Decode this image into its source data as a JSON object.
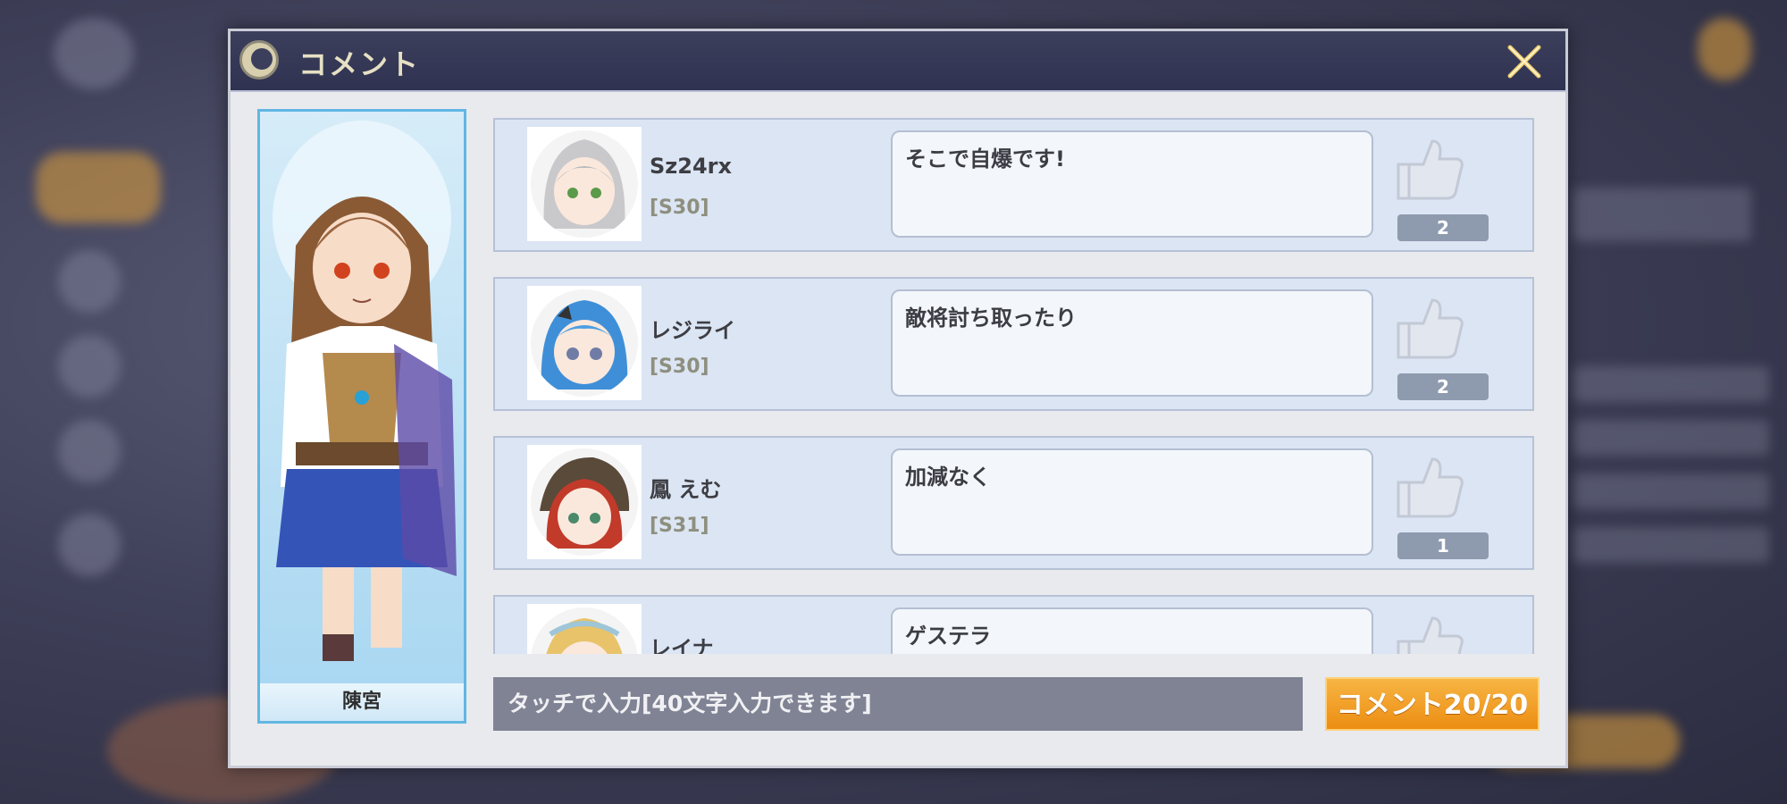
{
  "dialog": {
    "title": "コメント",
    "close_icon": "close-x-icon",
    "character_name": "陳宮"
  },
  "comments": [
    {
      "user": "Sz24rx",
      "server": "[S30]",
      "text": "そこで自爆です!",
      "likes": "2"
    },
    {
      "user": "レジライ",
      "server": "[S30]",
      "text": "敵将討ち取ったり",
      "likes": "2"
    },
    {
      "user": "鳳 えむ",
      "server": "[S31]",
      "text": "加減なく",
      "likes": "1"
    },
    {
      "user": "レイナ",
      "server": "",
      "text": "ゲステラ",
      "likes": ""
    }
  ],
  "input": {
    "placeholder": "タッチで入力[40文字入力できます]"
  },
  "submit": {
    "label": "コメント20/20"
  },
  "colors": {
    "header": "#2f3250",
    "accent_orange": "#ec8d12",
    "row_bg": "#dbe5f3"
  }
}
